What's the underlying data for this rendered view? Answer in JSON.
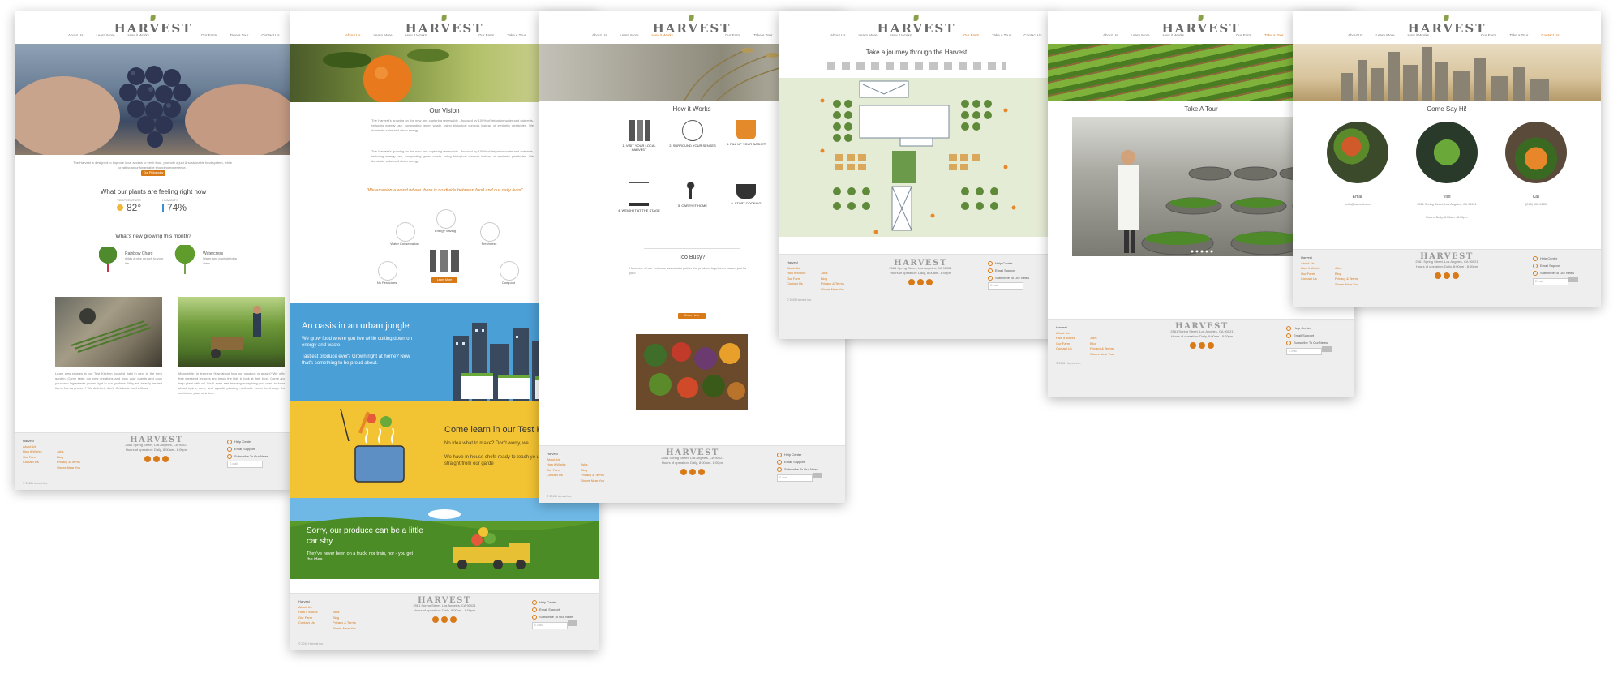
{
  "brand": {
    "logo": "HARVEST",
    "accent": "#d97a18"
  },
  "nav": [
    "About Us",
    "Learn More",
    "How it Works",
    "Our Farm",
    "Take A Tour",
    "Contact Us"
  ],
  "footer": {
    "heading": "Harvest",
    "col1": [
      "About Us",
      "How it Works",
      "Our Farm",
      "Contact Us"
    ],
    "col2": [
      "Jobs",
      "Blog",
      "Privacy & Terms",
      "Stores Near You"
    ],
    "address": "2561 Spring Street, Los Angeles, CA 90021",
    "hours": "Hours of operation: Daily, 8:00am - 8:00pm",
    "links": [
      "Help Center",
      "Email Support",
      "Subscribe To Our News"
    ],
    "email_placeholder": "E-mail",
    "copyright": "© 2015 Harvest Inc."
  },
  "page1": {
    "intro": "The Harvest is designed to improve local access to fresh food, promote a just & sustainable food system, while creating an unforgettable shopping experience.",
    "button": "Our Philosophy",
    "plants_title": "What our plants are feeling right now",
    "temp_label": "TEMPERATURE",
    "temp_value": "82°",
    "humidity_label": "HUMIDITY",
    "humidity_value": "74%",
    "growing_title": "What's new growing this month?",
    "item1_title": "Rainbow Chard",
    "item1_text": "Adds a nice crunch to your life.",
    "item2_title": "Watercress",
    "item2_text": "Water and a whole lotta class.",
    "para1": "Learn new recipes in our Test Kitchen, located right in next to the herb garden. Come taste our new creations and wow your guests and cook your own ingredients grown right in our gardens. Why eat heavily treated items from a grocery? We definitely don't. Celebrate food with us.",
    "para2": "Meanwhile, in learning, How about how our produce is grown? We offer free weekend lectures and teach the kids to look at their food. Come and help plant with us! You'll even see brewing everything you need to know about hydro, aero, and aquatic planting methods. Learn to change the world one plant at a time."
  },
  "page2": {
    "title": "Our Vision",
    "para": "The Harvest's growing on the new and capturing renewable - focused by 100% of irrigation water and nutrients, reducing energy use, composting green waste, using biological controls instead of synthetic pesticides. We dominate solar and clean energy.",
    "quote": "\"We envision a world where there is no divide between food and our daily lives\"",
    "icons": [
      "Water Conservation",
      "Energy Saving",
      "Freshness",
      "No Pesticides",
      "Compost"
    ],
    "btn": "Learn More",
    "band1_title": "An oasis in an urban jungle",
    "band1_text": "We grow food where you live while cutting down on energy and waste.",
    "band1_text2": "Tastiest produce ever? Grown right at home? Now that's something to be proud about.",
    "band2_title": "Come learn in our Test K",
    "band2_text": "No idea what to make? Don't worry, we",
    "band2_text2": "We have in-house chefs ready to teach yo using ingredients straight from our garde",
    "band3_title": "Sorry, our produce can be a little car shy",
    "band3_text": "They've never been on a truck, nor train, nor - you get the idea."
  },
  "page3": {
    "title": "How it Works",
    "steps": [
      "1. VISIT YOUR LOCAL HARVEST",
      "2. SURROUND YOUR SENSES",
      "3. FILL UP YOUR BASKET",
      "4. WEIGH IT AT THE STAGE",
      "5. CARRY IT HOME",
      "6. START COOKING"
    ],
    "busy_title": "Too Busy?",
    "busy_text": "Have one of our in-house associates gather the produce together a basket just for you!",
    "btn": "Order Here"
  },
  "page4": {
    "title": "Take a journey through the Harvest"
  },
  "page5": {
    "title": "Take A Tour"
  },
  "page6": {
    "title": "Come Say Hi!",
    "email_label": "Email",
    "email_value": "hello@harvest.com",
    "visit_label": "Visit",
    "visit_value": "2561 Spring Street, Los Angeles, CA 90021",
    "call_label": "Call",
    "call_value": "(213) 555-0180",
    "hours": "Hours: Daily, 8:00am - 8:00pm"
  }
}
